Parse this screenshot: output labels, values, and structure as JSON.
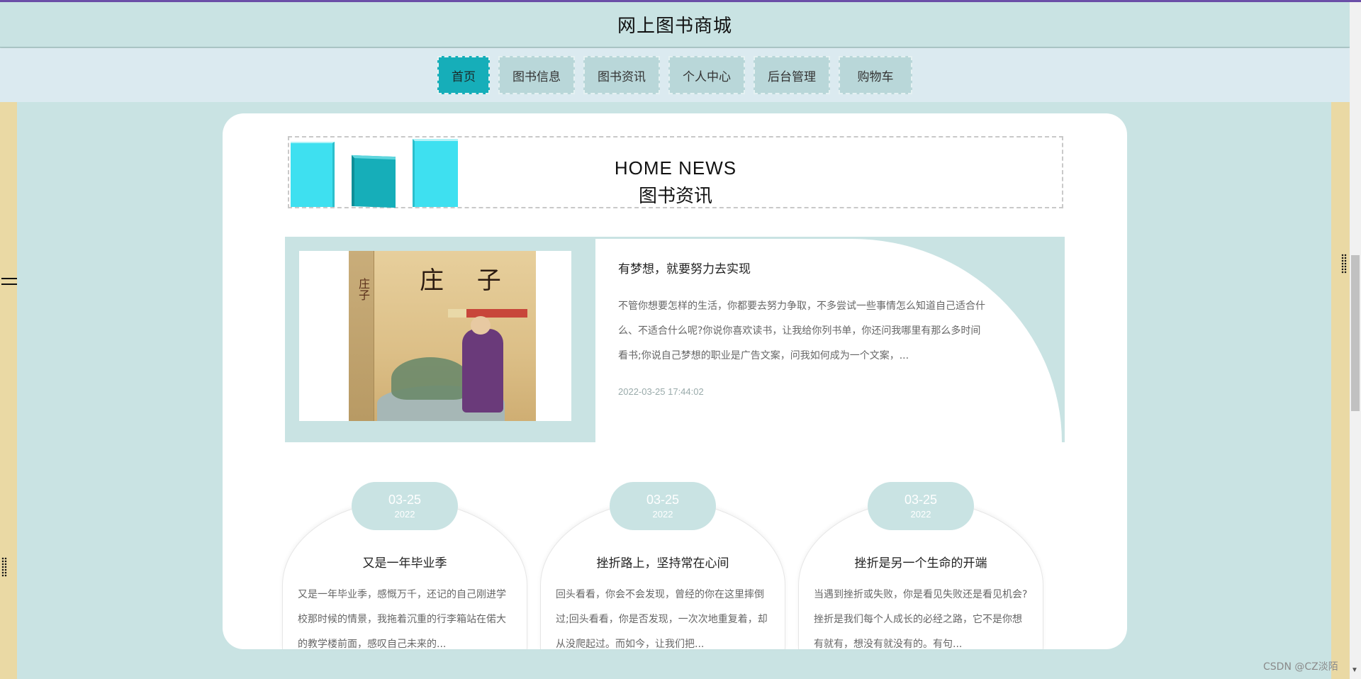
{
  "site": {
    "title": "网上图书商城"
  },
  "nav": {
    "items": [
      {
        "label": "首页",
        "active": true
      },
      {
        "label": "图书信息"
      },
      {
        "label": "图书资讯"
      },
      {
        "label": "个人中心"
      },
      {
        "label": "后台管理"
      },
      {
        "label": "购物车"
      }
    ]
  },
  "section": {
    "title_en": "HOME NEWS",
    "title_cn": "图书资讯"
  },
  "featured": {
    "book_title": "庄 子",
    "book_spine": "庄子",
    "title": "有梦想，就要努力去实现",
    "text": "不管你想要怎样的生活，你都要去努力争取，不多尝试一些事情怎么知道自己适合什么、不适合什么呢?你说你喜欢读书，让我给你列书单，你还问我哪里有那么多时间看书;你说自己梦想的职业是广告文案，问我如何成为一个文案，...",
    "date": "2022-03-25 17:44:02"
  },
  "cards": [
    {
      "day": "03-25",
      "year": "2022",
      "title": "又是一年毕业季",
      "text": "又是一年毕业季，感慨万千，还记的自己刚进学校那时候的情景，我拖着沉重的行李箱站在偌大的教学楼前面，感叹自己未来的..."
    },
    {
      "day": "03-25",
      "year": "2022",
      "title": "挫折路上，坚持常在心间",
      "text": "回头看看，你会不会发现，曾经的你在这里摔倒过;回头看看，你是否发现，一次次地重复着，却从没爬起过。而如今，让我们把..."
    },
    {
      "day": "03-25",
      "year": "2022",
      "title": "挫折是另一个生命的开端",
      "text": "当遇到挫折或失败，你是看见失败还是看见机会?挫折是我们每个人成长的必经之路，它不是你想有就有，想没有就没有的。有句..."
    }
  ],
  "watermark": "CSDN @CZ淡陌",
  "colors": {
    "accent": "#16aeb9",
    "base": "#c9e3e3",
    "side": "#ead9a4",
    "nav_bg": "#dbeaf0"
  }
}
